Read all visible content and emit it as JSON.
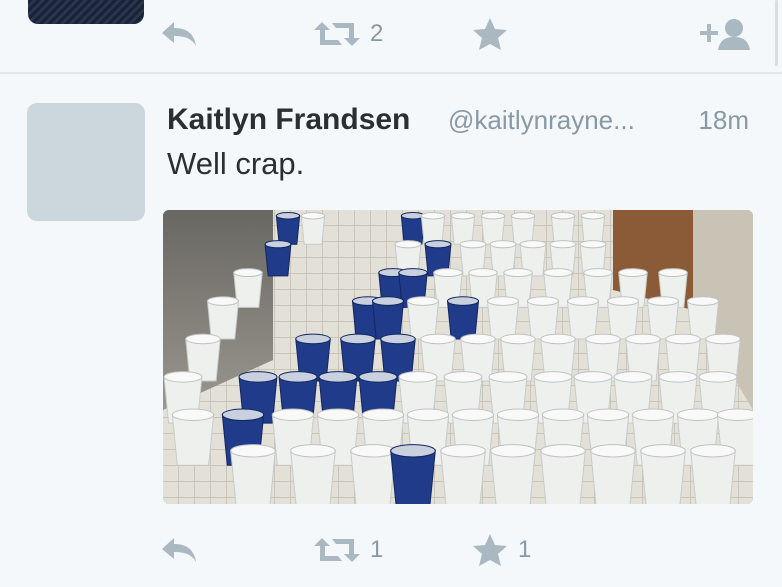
{
  "previous_tweet": {
    "retweet_count": "2"
  },
  "tweet": {
    "author_name": "Kaitlyn Frandsen",
    "author_handle": "@kaitlynrayne...",
    "timestamp": "18m",
    "text": "Well crap.",
    "retweet_count": "1",
    "favorite_count": "1",
    "media_description_icon": "photo"
  },
  "colors": {
    "background": "#f5f8fa",
    "text": "#292f33",
    "muted": "#8899a6",
    "avatar_placeholder": "#ccd6dd",
    "divider": "#e1e8ed"
  },
  "icons": [
    "reply-icon",
    "retweet-icon",
    "favorite-icon",
    "follow-icon"
  ]
}
